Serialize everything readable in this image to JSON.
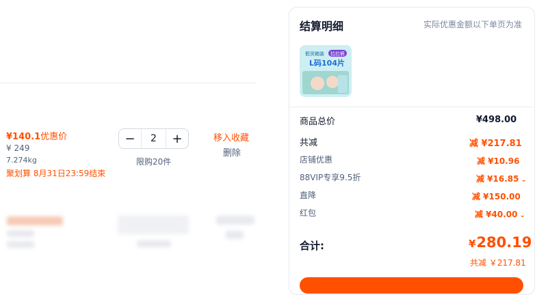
{
  "cart_item": {
    "promo_price": "¥140.1",
    "promo_label": "优惠价",
    "original_price": "¥ 249",
    "weight": "7.274kg",
    "promo_deadline": "聚划算 8月31日23:59结束",
    "quantity": "2",
    "limit_text": "限购20件",
    "collect_label": "移入收藏",
    "delete_label": "删除",
    "minus_symbol": "−",
    "plus_symbol": "+"
  },
  "summary": {
    "title": "结算明细",
    "note": "实际优惠金额以下单页为准",
    "product_thumb": {
      "tag": "拉拉裤",
      "line1": "假货箱装",
      "line2": "L码104片"
    },
    "rows": [
      {
        "label": "商品总价",
        "value": "¥498.00",
        "style": "dark"
      },
      {
        "label": "共减",
        "value": "减 ¥217.81",
        "style": "orange"
      },
      {
        "label": "店铺优惠",
        "value": "减 ¥10.96",
        "style": "orange-sm"
      },
      {
        "label": "88VIP专享9.5折",
        "value": "减 ¥16.85",
        "style": "orange-sm",
        "chevron": true
      },
      {
        "label": "直降",
        "value": "减 ¥150.00",
        "style": "orange-sm"
      },
      {
        "label": "红包",
        "value": "减 ¥40.00",
        "style": "orange-sm",
        "chevron": true
      }
    ],
    "total_label": "合计:",
    "total_currency": "¥",
    "total_value": "280.19",
    "total_savings": "共减 ￥217.81"
  },
  "colors": {
    "accent": "#ff5000",
    "text": "#11192d",
    "muted": "#50607a"
  }
}
